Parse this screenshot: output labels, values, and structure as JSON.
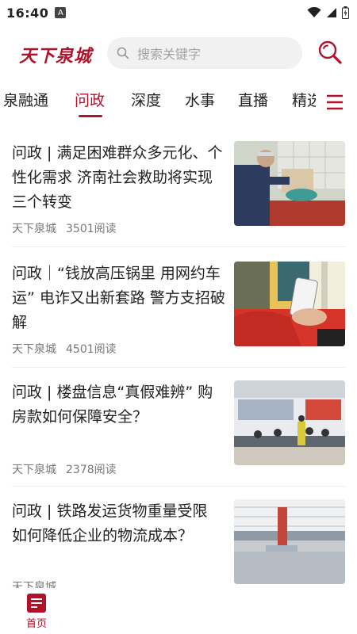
{
  "status": {
    "time": "16:40",
    "notification_badge": "A",
    "icons": [
      "wifi-icon",
      "signal-icon",
      "battery-icon"
    ]
  },
  "header": {
    "logo_text": "天下泉城",
    "search_placeholder": "搜索关键字"
  },
  "nav": {
    "tabs": [
      {
        "label": "泉融通",
        "active": false
      },
      {
        "label": "问政",
        "active": true
      },
      {
        "label": "深度",
        "active": false
      },
      {
        "label": "水事",
        "active": false
      },
      {
        "label": "直播",
        "active": false
      },
      {
        "label": "精选",
        "active": false
      }
    ],
    "menu_icon": "hamburger-menu-icon"
  },
  "articles": [
    {
      "title": "问政 | 满足困难群众多元化、个性化需求 济南社会救助将实现三个转变",
      "source": "天下泉城",
      "reads": "3501阅读",
      "image": "elderly man washing dishes at kitchen sink"
    },
    {
      "title": "问政｜“钱放高压锅里 用网约车运” 电诈又出新套路 警方支招破解",
      "source": "天下泉城",
      "reads": "4501阅读",
      "image": "hand holding smartphone"
    },
    {
      "title": "问政 | 楼盘信息“真假难辨” 购房款如何保障安全？",
      "source": "天下泉城",
      "reads": "2378阅读",
      "image": "office service hall with people"
    },
    {
      "title": "问政 | 铁路发运货物重量受限 如何降低企业的物流成本？",
      "source": "天下泉城",
      "reads": "",
      "image": "industrial warehouse with crane"
    }
  ],
  "bottom_nav": {
    "home_label": "首页",
    "home_icon": "document-list-icon"
  },
  "colors": {
    "accent": "#b0122a",
    "text": "#222222",
    "meta": "#777777",
    "search_bg": "#f1f1f1"
  }
}
